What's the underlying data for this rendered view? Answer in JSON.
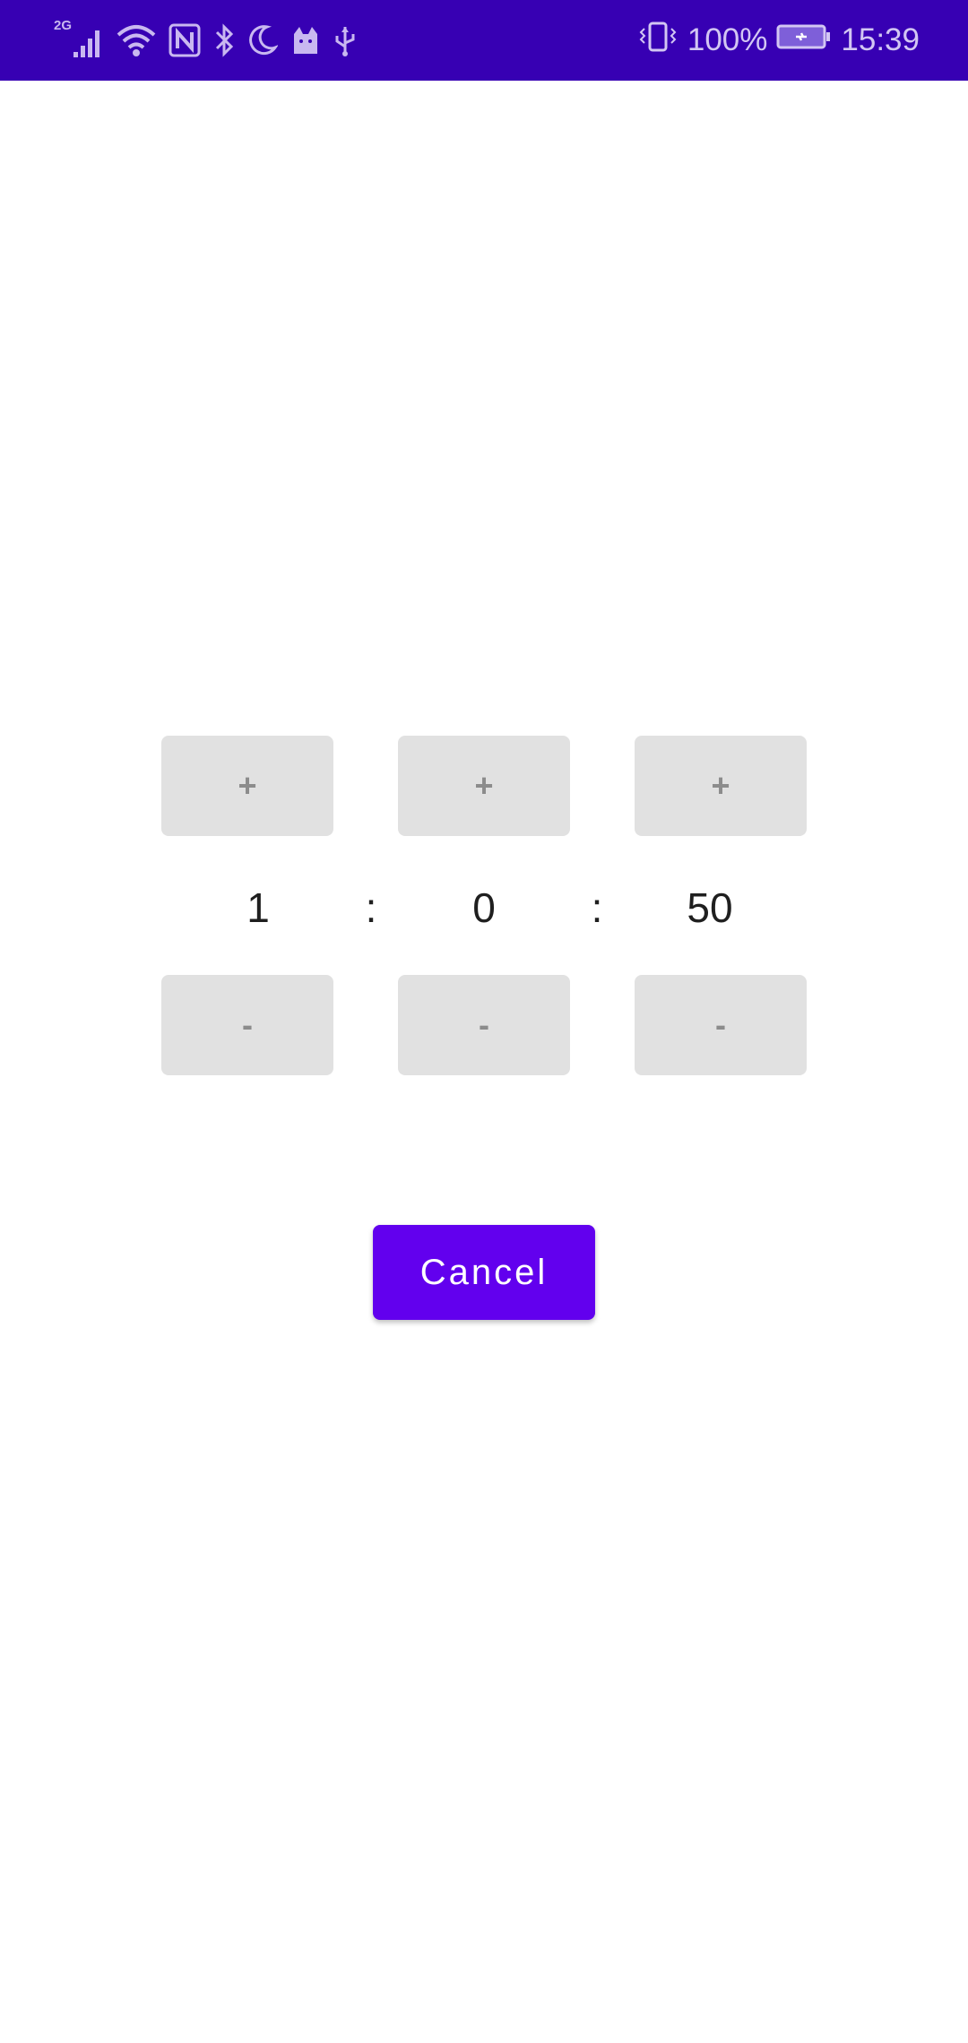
{
  "status_bar": {
    "network_type": "2G",
    "battery_percent": "100%",
    "time": "15:39",
    "background_color": "#3700b3",
    "left_icons": [
      "signal-icon",
      "wifi-icon",
      "nfc-icon",
      "bluetooth-icon",
      "do-not-disturb-icon",
      "cat-app-icon",
      "usb-icon"
    ],
    "right_icons": [
      "vibrate-icon",
      "battery-charging-icon"
    ]
  },
  "timer_picker": {
    "increment_label": "+",
    "decrement_label": "-",
    "hours": "1",
    "minutes": "0",
    "seconds": "50",
    "separator": ":"
  },
  "cancel_button": {
    "label": "Cancel",
    "color": "#6200ee"
  }
}
